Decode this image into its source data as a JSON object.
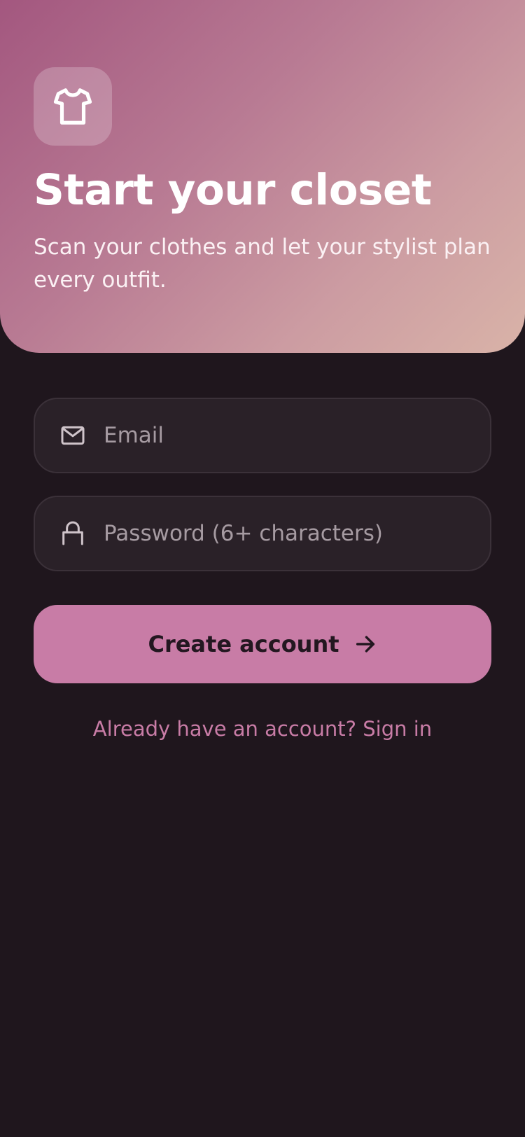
{
  "colors": {
    "background": "#1f161d",
    "accent": "#c87ca6",
    "field_background": "#2a2128",
    "hero_gradient": [
      "#a3577f",
      "#d9b3a8"
    ]
  },
  "hero": {
    "icon": "tshirt-icon",
    "title": "Start your closet",
    "subtitle": "Scan your clothes and let your stylist plan every outfit."
  },
  "form": {
    "email": {
      "icon": "mail-icon",
      "placeholder": "Email",
      "value": ""
    },
    "password": {
      "icon": "lock-icon",
      "placeholder": "Password (6+ characters)",
      "value": ""
    },
    "submit": {
      "label": "Create account",
      "icon": "arrow-right-icon"
    }
  },
  "footer": {
    "signin_link": "Already have an account? Sign in"
  }
}
